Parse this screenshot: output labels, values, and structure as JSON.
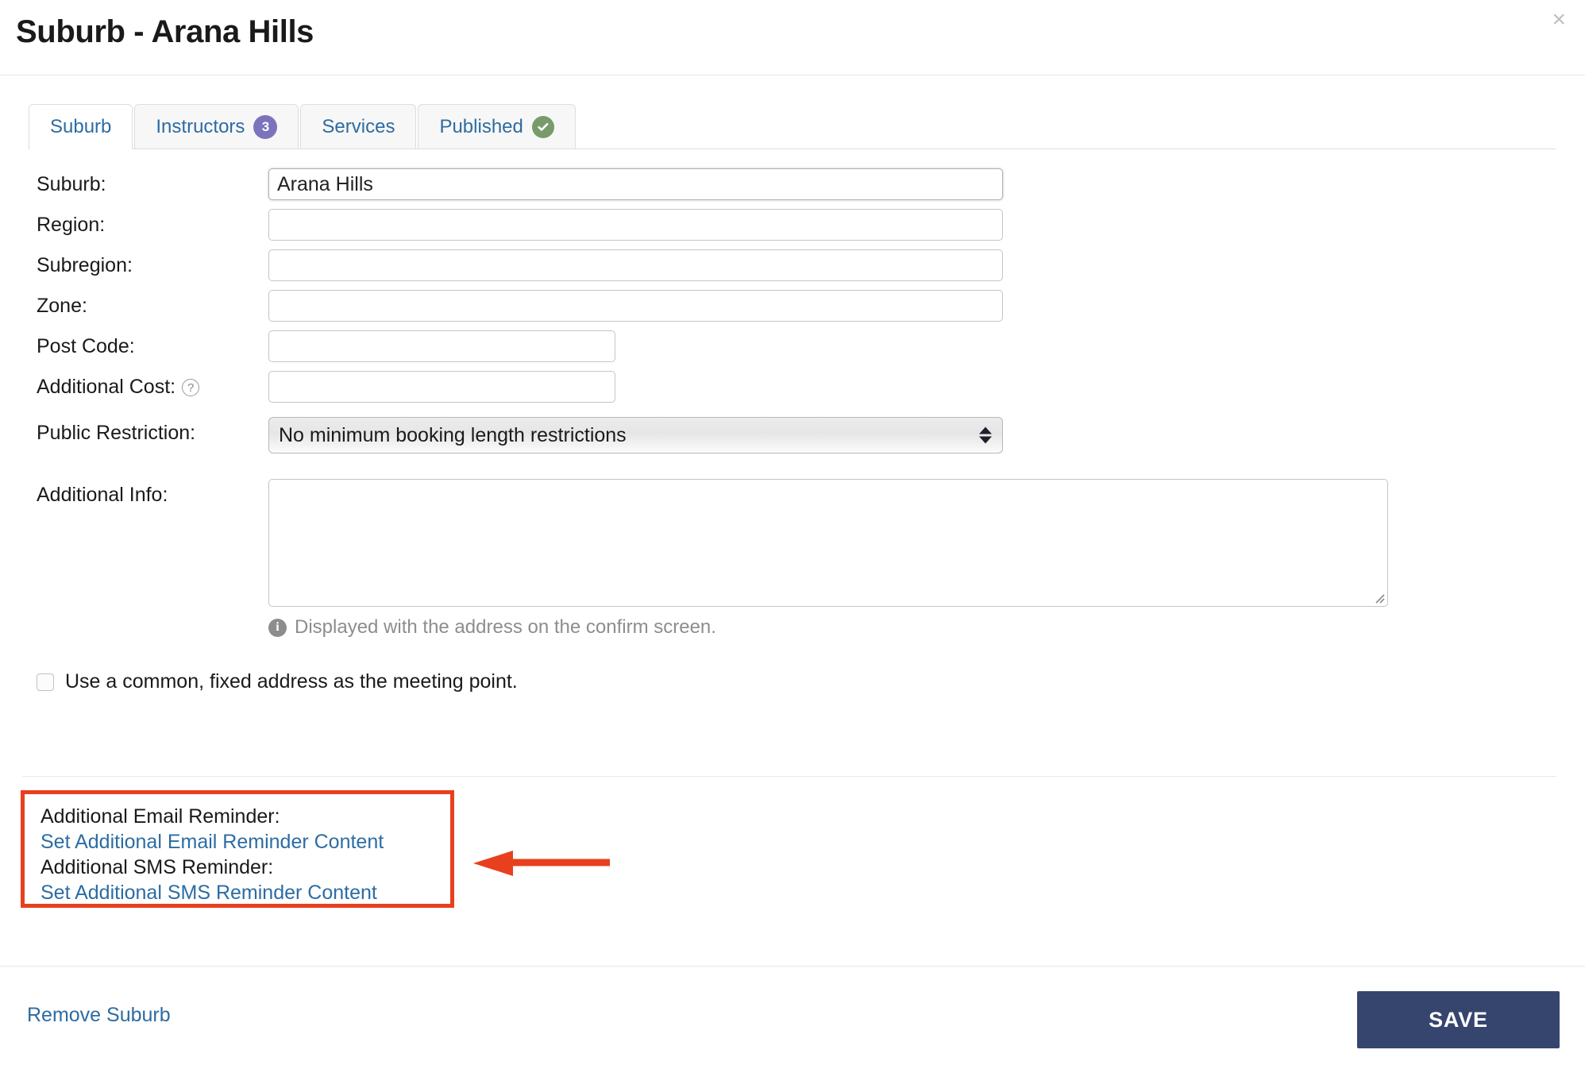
{
  "header": {
    "title": "Suburb - Arana Hills",
    "close_label": "×"
  },
  "tabs": [
    {
      "label": "Suburb",
      "active": true,
      "badge": null,
      "icon": null
    },
    {
      "label": "Instructors",
      "active": false,
      "badge": "3",
      "icon": null
    },
    {
      "label": "Services",
      "active": false,
      "badge": null,
      "icon": null
    },
    {
      "label": "Published",
      "active": false,
      "badge": null,
      "icon": "check-circle-icon"
    }
  ],
  "form": {
    "suburb": {
      "label": "Suburb:",
      "value": "Arana Hills",
      "placeholder": ""
    },
    "region": {
      "label": "Region:",
      "value": "",
      "placeholder": ""
    },
    "subregion": {
      "label": "Subregion:",
      "value": "",
      "placeholder": ""
    },
    "zone": {
      "label": "Zone:",
      "value": "",
      "placeholder": ""
    },
    "post_code": {
      "label": "Post Code:",
      "value": "",
      "placeholder": ""
    },
    "additional_cost": {
      "label": "Additional Cost:",
      "value": "",
      "placeholder": "",
      "help_icon": "?"
    },
    "public_restriction": {
      "label": "Public Restriction:",
      "selected": "No minimum booking length restrictions"
    },
    "additional_info": {
      "label": "Additional Info:",
      "value": "",
      "placeholder": "",
      "hint": "Displayed with the address on the confirm screen.",
      "hint_icon": "i"
    },
    "fixed_address_checkbox": {
      "label": "Use a common, fixed address as the meeting point.",
      "checked": false
    }
  },
  "reminders": {
    "email_label": "Additional Email Reminder:",
    "email_link": "Set Additional Email Reminder Content",
    "sms_label": "Additional SMS Reminder:",
    "sms_link": "Set Additional SMS Reminder Content"
  },
  "footer": {
    "remove_label": "Remove Suburb",
    "save_label": "SAVE"
  },
  "colors": {
    "link": "#2c6ca3",
    "save_button": "#36456e",
    "badge": "#7b74bd",
    "published_check": "#789b6a",
    "highlight": "#e8401f"
  }
}
